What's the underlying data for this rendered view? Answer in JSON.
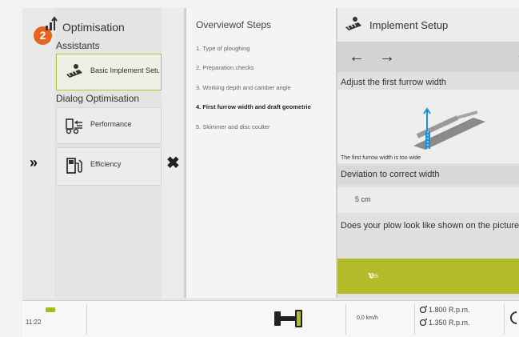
{
  "badge": "2",
  "menu": {
    "title": "Optimisation",
    "title_icon": "chart-arrow-up-icon",
    "section_assistants": "Assistants",
    "basic_implement": "Basic Implement Setup",
    "section_dialog": "Dialog Optimisation",
    "performance": "Performance",
    "efficiency": "Efficiency",
    "expand_icon": "double-chevron-right-icon",
    "close_icon": "close-icon"
  },
  "steps": {
    "title": "Overviewof Steps",
    "items": [
      "1. Type of ploughing",
      "2. Preparation checks",
      "3. Working depth and camber angle",
      "4. First furrow width and draft geometrie",
      "5. Skimmer and disc coulter"
    ],
    "current_index": 3
  },
  "setup": {
    "title": "Implement Setup",
    "back_icon": "arrow-left-icon",
    "forward_icon": "arrow-right-icon",
    "adjust_label": "Adjust the first furrow width",
    "note": "The first furrow width is too wide",
    "deviation_label": "Deviation to correct width",
    "deviation_value": "5 cm",
    "question": "Does your plow look like shown on the picture?",
    "answer": "Yes"
  },
  "status": {
    "time": "11:22",
    "speed": "0,0 km/h",
    "rpm1": "1.800 R.p.m.",
    "rpm2": "1.350 R.p.m."
  },
  "colors": {
    "accent": "#b3bb29",
    "badge": "#e8641e"
  }
}
